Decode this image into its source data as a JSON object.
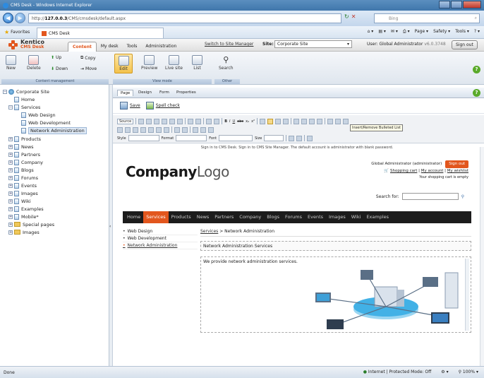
{
  "window": {
    "title": "CMS Desk - Windows Internet Explorer"
  },
  "browser": {
    "url_prefix": "http://",
    "url_host": "127.0.0.3",
    "url_path": "/CMS/cmsdesk/default.aspx",
    "search_placeholder": "Bing",
    "favorites_label": "Favorites",
    "tab_label": "CMS Desk",
    "commands": [
      "Page ▾",
      "Safety ▾",
      "Tools ▾"
    ]
  },
  "cms": {
    "logo_name": "Kentico",
    "logo_sub": "CMS Desk",
    "tabs": [
      "Content",
      "My desk",
      "Tools",
      "Administration"
    ],
    "switch_link": "Switch to Site Manager",
    "site_label": "Site:",
    "site_value": "Corporate Site",
    "user_label": "User: Global Administrator",
    "version": "v6.0.3748",
    "signout": "Sign out"
  },
  "ribbon": {
    "content_mgmt": {
      "new": "New",
      "delete": "Delete",
      "up": "Up",
      "down": "Down",
      "copy": "Copy",
      "move": "Move",
      "group": "Content management"
    },
    "view_mode": {
      "edit": "Edit",
      "preview": "Preview",
      "live": "Live site",
      "list": "List",
      "group": "View mode"
    },
    "other": {
      "search": "Search",
      "group": "Other"
    }
  },
  "tree": [
    {
      "label": "Corporate Site",
      "level": 0
    },
    {
      "label": "Home",
      "level": 1
    },
    {
      "label": "Services",
      "level": 1
    },
    {
      "label": "Web Design",
      "level": 2
    },
    {
      "label": "Web Development",
      "level": 2
    },
    {
      "label": "Network Administration",
      "level": 2
    },
    {
      "label": "Products",
      "level": 1
    },
    {
      "label": "News",
      "level": 1
    },
    {
      "label": "Partners",
      "level": 1
    },
    {
      "label": "Company",
      "level": 1
    },
    {
      "label": "Blogs",
      "level": 1
    },
    {
      "label": "Forums",
      "level": 1
    },
    {
      "label": "Events",
      "level": 1
    },
    {
      "label": "Images",
      "level": 1
    },
    {
      "label": "Wiki",
      "level": 1
    },
    {
      "label": "Examples",
      "level": 1
    },
    {
      "label": "Mobile*",
      "level": 1
    },
    {
      "label": "Special pages",
      "level": 1
    },
    {
      "label": "Images",
      "level": 1
    }
  ],
  "edit": {
    "subtabs": [
      "Page",
      "Design",
      "Form",
      "Properties"
    ],
    "save": "Save",
    "spell": "Spell check",
    "source": "Source",
    "style_lbl": "Style",
    "format_lbl": "Format",
    "font_lbl": "Font",
    "size_lbl": "Size",
    "tooltip": "Insert/Remove Bulleted List"
  },
  "site": {
    "signin_bar": "Sign in to CMS Desk. Sign in to CMS Site Manager. The default account is administrator with blank password.",
    "logo_bold": "Company",
    "logo_light": "Logo",
    "admin_line": "Global Administrator (administrator)",
    "signout_btn": "Sign out",
    "cart_link": "Shopping cart",
    "account_link": "My account",
    "wishlist_link": "My wishlist",
    "cart_empty": "Your shopping cart is empty",
    "search_for": "Search for:",
    "menu": [
      "Home",
      "Services",
      "Products",
      "News",
      "Partners",
      "Company",
      "Blogs",
      "Forums",
      "Events",
      "Images",
      "Wiki",
      "Examples"
    ],
    "menu_active": "Services",
    "leftnav": [
      "Web Design",
      "Web Development",
      "Network Administration"
    ],
    "crumb_link": "Services",
    "crumb_rest": " > Network Administration",
    "heading": "Network Administration Services",
    "body": "We provide network administration services."
  },
  "status": {
    "left": "Done",
    "zone": "Internet | Protected Mode: Off",
    "zoom": "100%"
  }
}
